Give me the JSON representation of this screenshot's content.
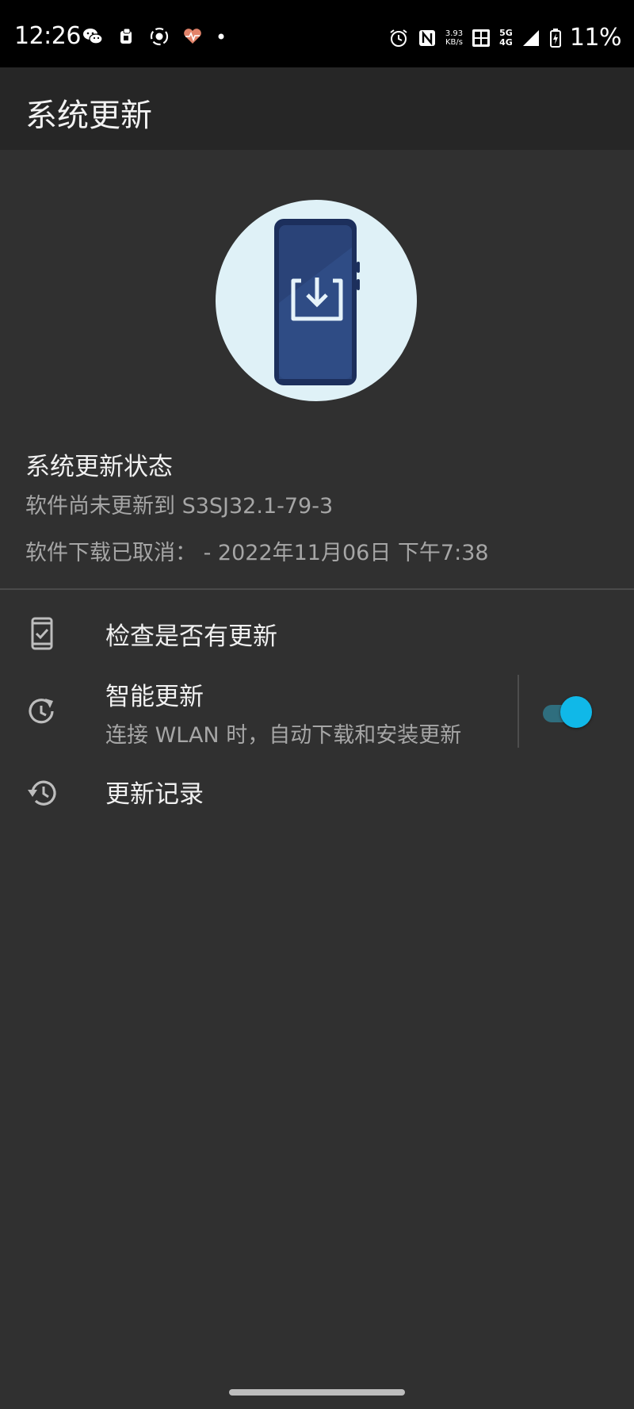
{
  "status_bar": {
    "time": "12:26",
    "speed_value": "3.93",
    "speed_unit": "KB/s",
    "net_top": "5G",
    "net_bottom": "4G",
    "battery": "11%",
    "icons": [
      "wechat-icon",
      "app-icon",
      "camera-record-icon",
      "health-icon",
      "dot-icon",
      "alarm-icon",
      "nfc-icon",
      "hd-icon",
      "signal-icon",
      "battery-charging-icon"
    ]
  },
  "app_bar": {
    "title": "系统更新"
  },
  "status": {
    "title": "系统更新状态",
    "line1": "软件尚未更新到 S3SJ32.1-79-3",
    "line2": "软件下载已取消：  - 2022年11月06日 下午7:38"
  },
  "menu": {
    "check_update": {
      "label": "检查是否有更新",
      "icon": "phone-check-icon"
    },
    "smart_update": {
      "label": "智能更新",
      "subtitle": "连接 WLAN 时，自动下载和安装更新",
      "icon": "refresh-clock-icon",
      "enabled": true
    },
    "history": {
      "label": "更新记录",
      "icon": "history-icon"
    }
  },
  "colors": {
    "accent": "#10b8e8",
    "background": "#303030",
    "app_bar": "#262626"
  }
}
